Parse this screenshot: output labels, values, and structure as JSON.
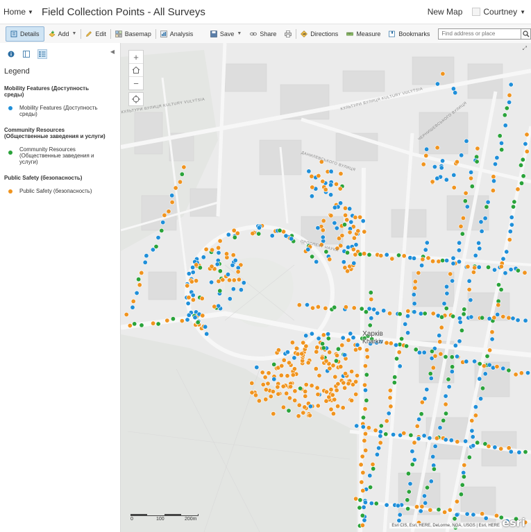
{
  "header": {
    "home_label": "Home",
    "map_title": "Field Collection Points - All Surveys",
    "new_map_label": "New Map",
    "user_name": "Courtney"
  },
  "toolbar": {
    "details": "Details",
    "add": "Add",
    "edit": "Edit",
    "basemap": "Basemap",
    "analysis": "Analysis",
    "save": "Save",
    "share": "Share",
    "directions": "Directions",
    "measure": "Measure",
    "bookmarks": "Bookmarks",
    "search_placeholder": "Find address or place"
  },
  "legend": {
    "title": "Legend",
    "layers": [
      {
        "header": "Mobility Features (Доступность среды)",
        "label": "Mobility Features (Доступность среды)",
        "color": "#1f8fd9"
      },
      {
        "header": "Community Resources (Общественные заведения и услуги)",
        "label": "Community Resources (Общественные заведения и услуги)",
        "color": "#2aa33a"
      },
      {
        "header": "Public Safety (безопасность)",
        "label": "Public Safety (безопасность)",
        "color": "#f0941f"
      }
    ]
  },
  "map": {
    "city_label_ua": "Харків",
    "city_label_en": "Kharkiv",
    "street_labels": [
      "КУЛЬТУРИ ВУЛИЦЯ KULTURY VULYTSIA",
      "КУЛЬТУРИ ВУЛИЦЯ KULTURY VULYTSIA",
      "ДАНИЛЕВСЬКОГО ВУЛИЦЯ",
      "ПРОСПЕКТ НАУКИ",
      "ЧЕРНИШЕВСЬКОГО ВУЛИЦЯ"
    ],
    "scale": {
      "labels": [
        "0",
        "100",
        "200m"
      ]
    },
    "attribution": "Esri CIS, Esri, HERE, DeLorme, NGA, USGS | Esri, HERE",
    "esri_logo": "esri",
    "colors": {
      "mobility": "#1f8fd9",
      "community": "#2aa33a",
      "safety": "#f0941f"
    }
  }
}
